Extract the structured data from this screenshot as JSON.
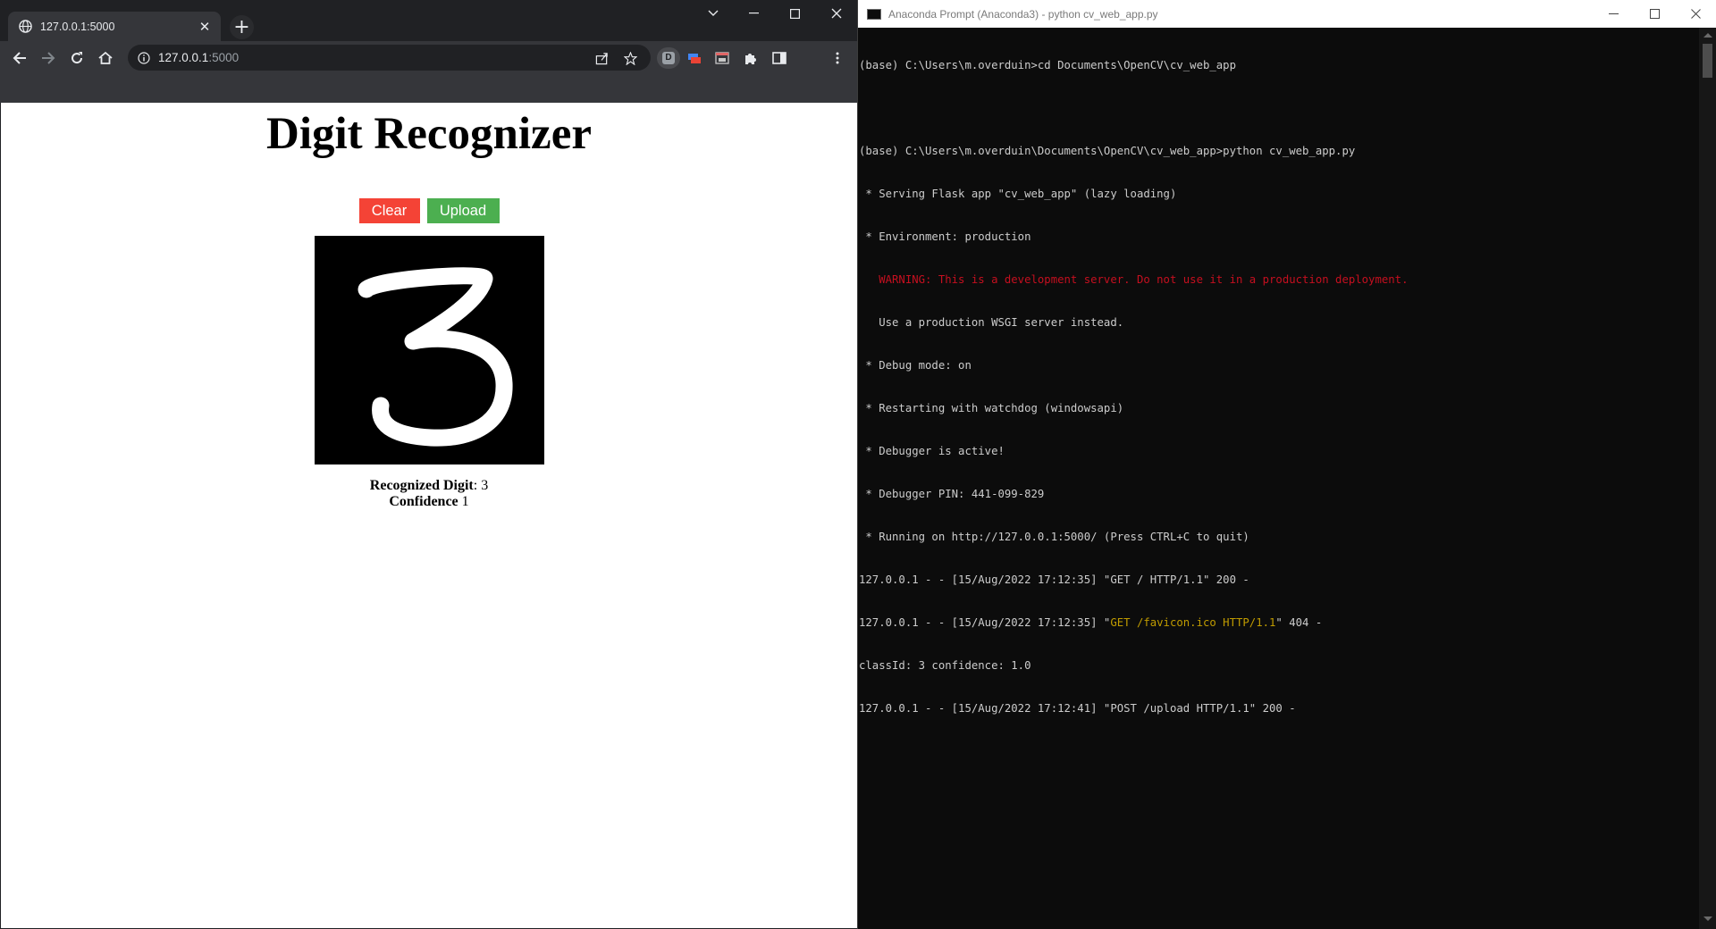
{
  "browser": {
    "tab_title": "127.0.0.1:5000",
    "new_tab_label": "+",
    "url_host": "127.0.0.1",
    "url_port": ":5000",
    "extension_badge": "D"
  },
  "page": {
    "title": "Digit Recognizer",
    "clear_label": "Clear",
    "upload_label": "Upload",
    "canvas_digit": "3",
    "result_digit_label": "Recognized Digit",
    "result_digit_value": ": 3",
    "result_conf_label": "Confidence",
    "result_conf_value": " 1"
  },
  "console": {
    "title": "Anaconda Prompt (Anaconda3) - python  cv_web_app.py",
    "lines": {
      "l1": "(base) C:\\Users\\m.overduin>cd Documents\\OpenCV\\cv_web_app",
      "l2": "",
      "l3": "(base) C:\\Users\\m.overduin\\Documents\\OpenCV\\cv_web_app>python cv_web_app.py",
      "l4": " * Serving Flask app \"cv_web_app\" (lazy loading)",
      "l5": " * Environment: production",
      "l6": "   WARNING: This is a development server. Do not use it in a production deployment.",
      "l7": "   Use a production WSGI server instead.",
      "l8": " * Debug mode: on",
      "l9": " * Restarting with watchdog (windowsapi)",
      "l10": " * Debugger is active!",
      "l11": " * Debugger PIN: 441-099-829",
      "l12": " * Running on http://127.0.0.1:5000/ (Press CTRL+C to quit)",
      "l13": "127.0.0.1 - - [15/Aug/2022 17:12:35] \"GET / HTTP/1.1\" 200 -",
      "l14a": "127.0.0.1 - - [15/Aug/2022 17:12:35] \"",
      "l14b": "GET /favicon.ico HTTP/1.1",
      "l14c": "\" 404 -",
      "l15": "classId: 3 confidence: 1.0",
      "l16": "127.0.0.1 - - [15/Aug/2022 17:12:41] \"POST /upload HTTP/1.1\" 200 -"
    }
  },
  "colors": {
    "clear_button": "#f44336",
    "upload_button": "#4caf50",
    "console_warning": "#c50f1f",
    "console_highlight": "#c19c00"
  }
}
